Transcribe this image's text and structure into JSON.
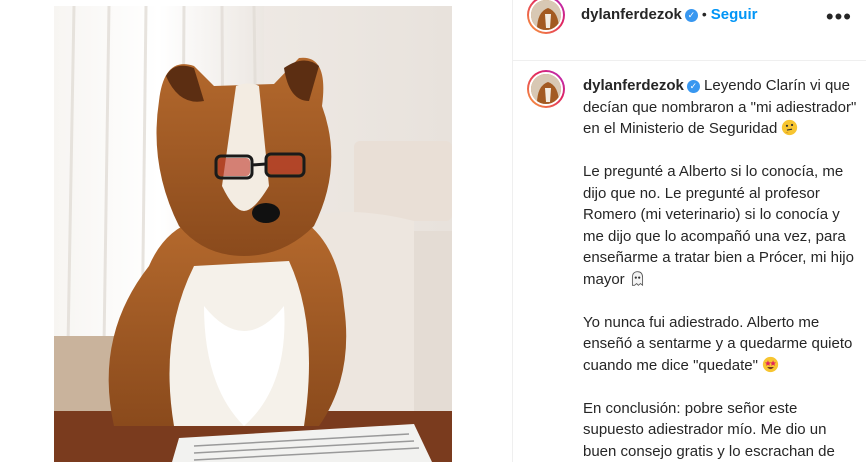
{
  "post": {
    "username": "dylanferdezok",
    "verified_icon": "verified-badge-icon",
    "separator": "•",
    "follow_label": "Seguir",
    "more_icon": "more-horizontal-icon",
    "more_glyph": "•••"
  },
  "caption": {
    "username": "dylanferdezok",
    "paragraph1": "Leyendo Clarín vi que decían que nombraron a \"mi adiestrador\" en el Ministerio de Seguridad",
    "paragraph2": "Le pregunté a Alberto si lo conocía, me dijo que no. Le pregunté al profesor Romero (mi veterinario) si lo conocía y me dijo que lo acompañó una vez, para enseñarme a tratar bien a Prócer, mi hijo mayor",
    "paragraph3": "Yo nunca fui adiestrado. Alberto me enseñó a sentarme y a quedarme quieto cuando me dice \"quedate\"",
    "paragraph4": "En conclusión: pobre señor este supuesto adiestrador mío. Me dio un buen consejo gratis y lo escrachan de este modo",
    "emoji1": "thinking-face-emoji",
    "emoji2": "ghost-emoji",
    "emoji3": "star-struck-emoji"
  },
  "colors": {
    "accent": "#0095f6",
    "verified": "#3897f0",
    "text": "#262626",
    "divider": "#efefef"
  }
}
